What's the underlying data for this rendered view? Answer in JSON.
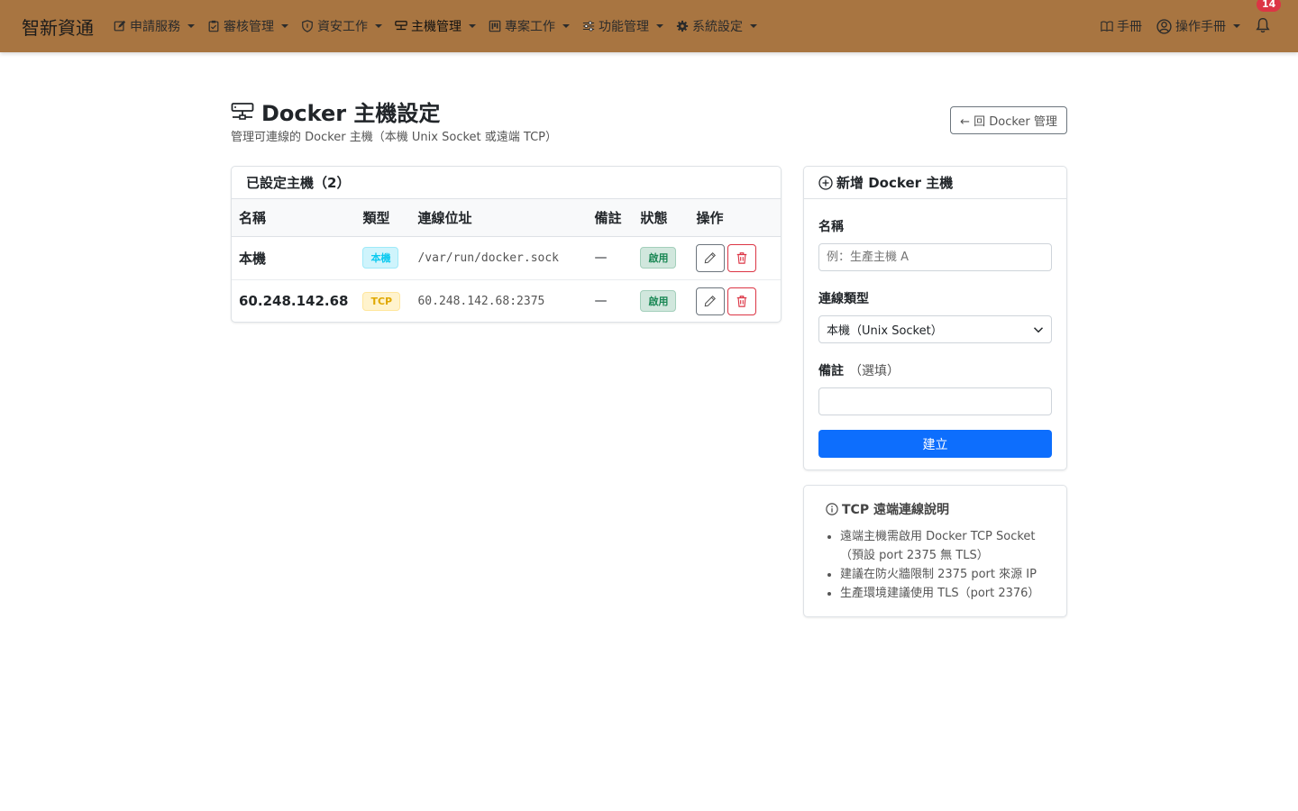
{
  "nav": {
    "brand": "智新資通",
    "items": [
      {
        "label": "申請服務",
        "icon": "pencil-square-icon"
      },
      {
        "label": "審核管理",
        "icon": "clipboard-check-icon"
      },
      {
        "label": "資安工作",
        "icon": "shield-icon"
      },
      {
        "label": "主機管理",
        "icon": "hdd-network-icon"
      },
      {
        "label": "專案工作",
        "icon": "kanban-icon"
      },
      {
        "label": "功能管理",
        "icon": "sliders-icon"
      },
      {
        "label": "系統設定",
        "icon": "gear-icon"
      }
    ],
    "manual": "手冊",
    "user": "操作手冊",
    "notification_count": "14"
  },
  "page": {
    "title": "Docker 主機設定",
    "subtitle": "管理可連線的 Docker 主機（本機 Unix Socket 或遠端 TCP）",
    "back": "← 回 Docker 管理"
  },
  "hosts": {
    "title": "已設定主機（2）",
    "columns": [
      "名稱",
      "類型",
      "連線位址",
      "備註",
      "狀態",
      "操作"
    ],
    "rows": [
      {
        "name": "本機",
        "type": "本機",
        "address": "/var/run/docker.sock",
        "note": "—",
        "status": "啟用"
      },
      {
        "name": "60.248.142.68",
        "type": "TCP",
        "address": "60.248.142.68:2375",
        "note": "—",
        "status": "啟用"
      }
    ]
  },
  "form": {
    "title": "新增 Docker 主機",
    "name_label": "名稱",
    "name_placeholder": "例：生產主機 A",
    "type_label": "連線類型",
    "type_value": "本機（Unix Socket）",
    "note_label": "備註",
    "note_optional": "（選填）",
    "submit": "建立"
  },
  "info": {
    "title": "TCP 遠端連線說明",
    "items": [
      "遠端主機需啟用 Docker TCP Socket（預設 port 2375 無 TLS）",
      "建議在防火牆限制 2375 port 來源 IP",
      "生產環境建議使用 TLS（port 2376）"
    ]
  },
  "colors": {
    "navbar": "#a87541",
    "primary": "#0d6efd",
    "danger": "#dc3545"
  }
}
